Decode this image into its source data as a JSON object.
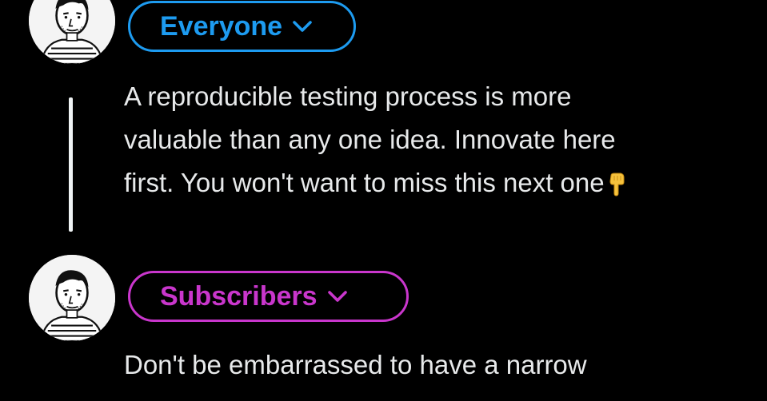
{
  "posts": [
    {
      "audience": {
        "label": "Everyone",
        "color": "#1d9bf0",
        "icon": "chevron-down-icon"
      },
      "avatar_icon": "avatar",
      "text_lines": [
        "A reproducible testing process is more",
        "valuable than any one idea. Innovate here",
        "first. You won't want to miss this next one"
      ],
      "trailing_emoji": "pointing-down-hand-emoji"
    },
    {
      "audience": {
        "label": "Subscribers",
        "color": "#c936cc",
        "icon": "chevron-down-icon"
      },
      "avatar_icon": "avatar",
      "text_lines": [
        "Don't be embarrassed to have a narrow"
      ]
    }
  ],
  "colors": {
    "background": "#000000",
    "text": "#e7e9ea",
    "thread_line": "#eff3f4"
  }
}
